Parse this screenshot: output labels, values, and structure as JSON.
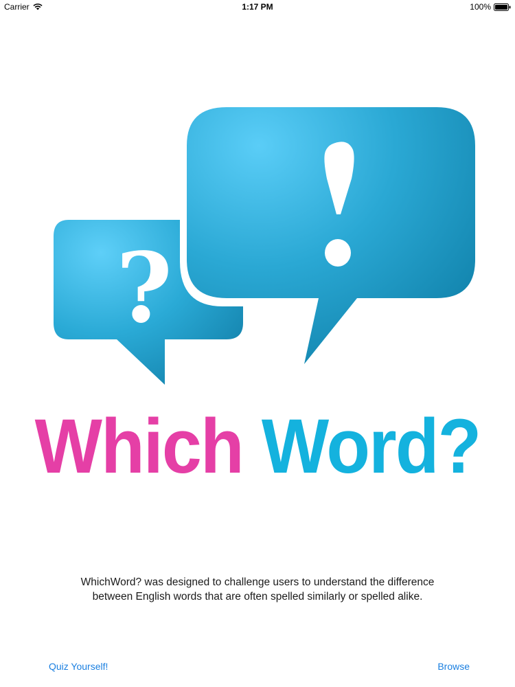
{
  "status_bar": {
    "carrier": "Carrier",
    "time": "1:17 PM",
    "battery": "100%"
  },
  "logo": {
    "left_bubble_symbol": "?",
    "right_bubble_symbol": "!",
    "bubble_color": "#1f9ec9",
    "bubble_highlight": "#53c8f5"
  },
  "title": {
    "part1": "Which",
    "part2": "Word?",
    "part1_color": "#e53fa6",
    "part2_color": "#14b2de"
  },
  "description": {
    "line1": "WhichWord? was designed to challenge users to understand the difference",
    "line2": "between English words that are often spelled similarly or spelled alike."
  },
  "links": {
    "quiz": "Quiz Yourself!",
    "browse": "Browse",
    "color": "#1a7fe0"
  }
}
